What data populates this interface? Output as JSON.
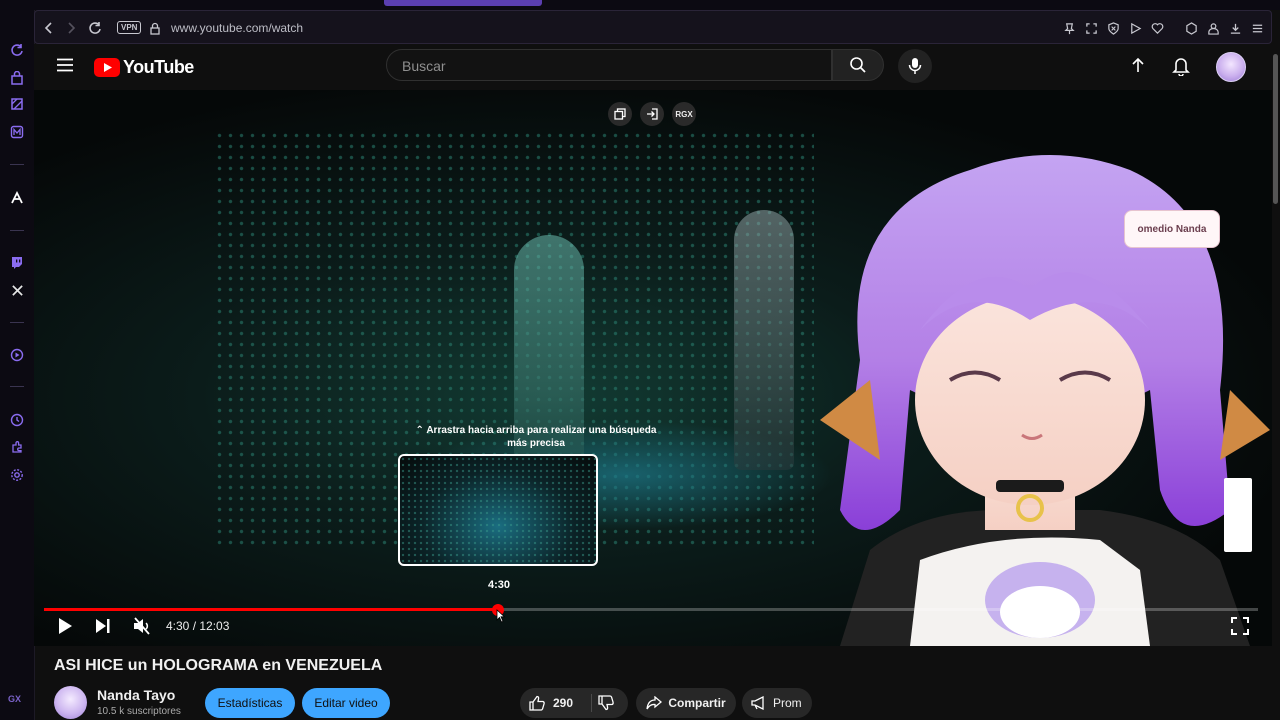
{
  "browser": {
    "url": "www.youtube.com/watch",
    "vpn_label": "VPN",
    "sidebar_label": "GX",
    "accent_color": "#8a6cf0"
  },
  "header": {
    "logo_text": "YouTube",
    "search_placeholder": "Buscar"
  },
  "player": {
    "overlay_buttons": [
      "copy-icon",
      "exit-icon",
      "RGX"
    ],
    "drag_hint": "⌃ Arrastra hacia arriba para realizar una búsqueda más precisa",
    "preview_time": "4:30",
    "current_time": "4:30",
    "duration": "12:03",
    "time_display": "4:30 / 12:03",
    "progress_fraction": 0.374,
    "bubble_text": "omedio Nanda",
    "progress_color": "#ff0000"
  },
  "video": {
    "title": "ASI HICE un HOLOGRAMA en VENEZUELA"
  },
  "channel": {
    "name": "Nanda Tayo",
    "subscribers": "10.5 k suscriptores"
  },
  "actions": {
    "stats_label": "Estadísticas",
    "edit_label": "Editar video",
    "like_count": "290",
    "share_label": "Compartir",
    "promote_label": "Prom"
  }
}
